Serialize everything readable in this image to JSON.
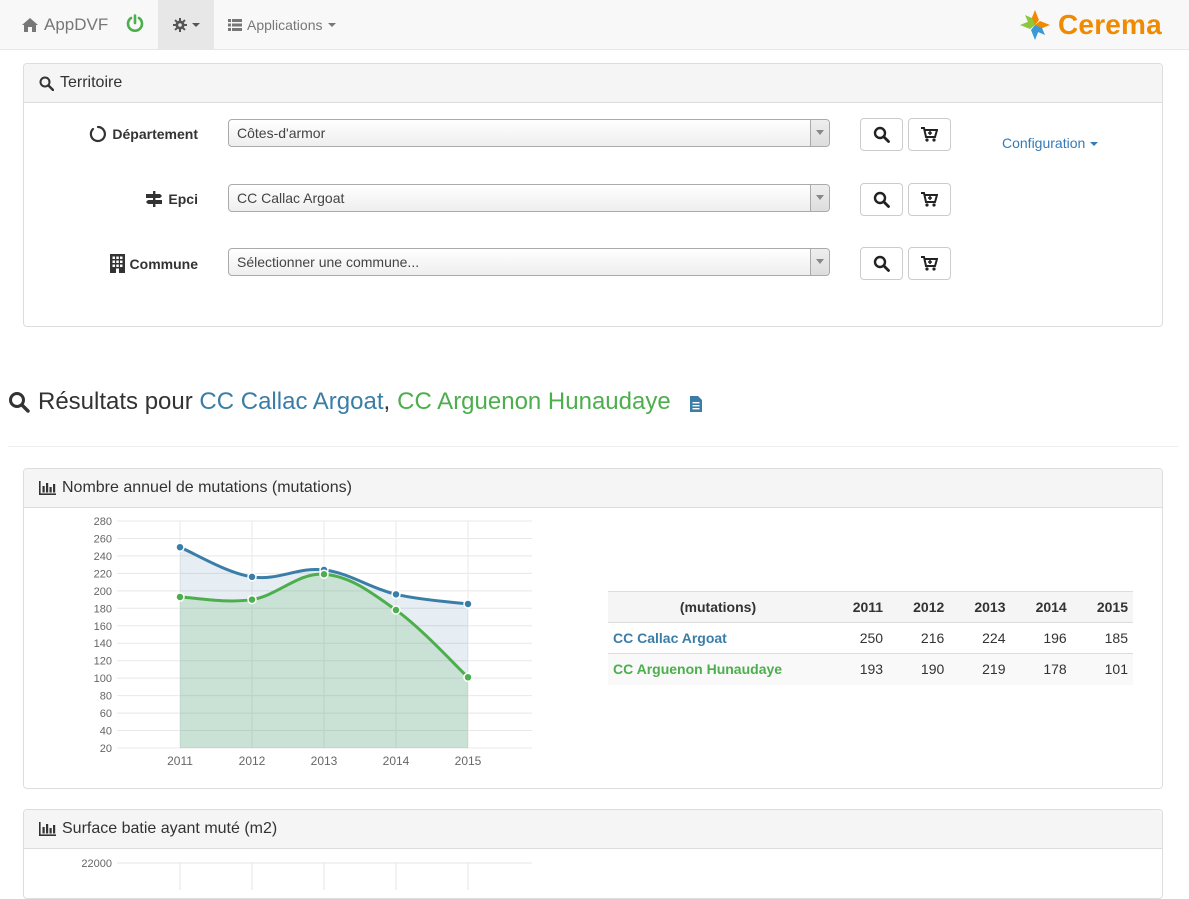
{
  "navbar": {
    "brand_label": "AppDVF",
    "apps_label": "Applications",
    "logo_text": "Cerema",
    "brand_colors": {
      "orange": "#f08a00",
      "green": "#8dc63f",
      "blue": "#3a9ad9"
    }
  },
  "territoire": {
    "heading": "Territoire",
    "rows": [
      {
        "label": "Département",
        "value": "Côtes-d'armor"
      },
      {
        "label": "Epci",
        "value": "CC Callac Argoat"
      },
      {
        "label": "Commune",
        "value": "Sélectionner une commune..."
      }
    ],
    "config_label": "Configuration"
  },
  "results": {
    "prefix": "Résultats pour ",
    "name_a": "CC Callac Argoat",
    "separator": ",",
    "name_b": "CC Arguenon Hunaudaye"
  },
  "panel_mutations": {
    "heading": "Nombre annuel de mutations (mutations)",
    "table": {
      "header_label": "(mutations)",
      "years": [
        "2011",
        "2012",
        "2013",
        "2014",
        "2015"
      ],
      "rows": [
        {
          "name": "CC Callac Argoat",
          "values": [
            "250",
            "216",
            "224",
            "196",
            "185"
          ]
        },
        {
          "name": "CC Arguenon Hunaudaye",
          "values": [
            "193",
            "190",
            "219",
            "178",
            "101"
          ]
        }
      ]
    }
  },
  "panel_surface": {
    "heading": "Surface batie ayant muté (m2)",
    "first_tick": "22000"
  },
  "chart_data": {
    "type": "area",
    "categories": [
      "2011",
      "2012",
      "2013",
      "2014",
      "2015"
    ],
    "series": [
      {
        "name": "CC Callac Argoat",
        "color": "#3a7ea8",
        "values": [
          250,
          216,
          224,
          196,
          185
        ]
      },
      {
        "name": "CC Arguenon Hunaudaye",
        "color": "#4cae4c",
        "values": [
          193,
          190,
          219,
          178,
          101
        ]
      }
    ],
    "yticks": [
      "20",
      "40",
      "60",
      "80",
      "100",
      "120",
      "140",
      "160",
      "180",
      "200",
      "220",
      "240",
      "260",
      "280"
    ],
    "ylim": [
      20,
      280
    ],
    "grid": true,
    "legend": "none"
  }
}
